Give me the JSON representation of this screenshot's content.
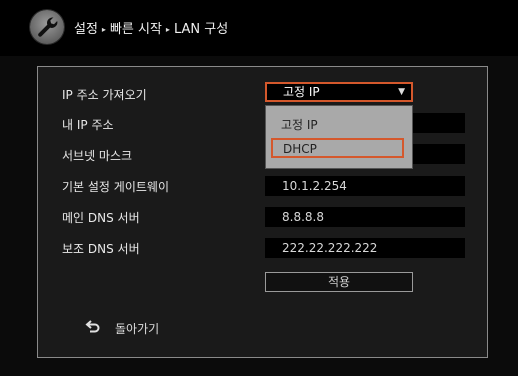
{
  "breadcrumb": {
    "items": [
      "설정",
      "빠른 시작",
      "LAN 구성"
    ],
    "separator": "▸"
  },
  "form": {
    "ip_mode": {
      "label": "IP 주소 가져오기",
      "value": "고정 IP",
      "arrow": "▼"
    },
    "ip_mode_options": [
      "고정 IP",
      "DHCP"
    ],
    "my_ip": {
      "label": "내 IP 주소",
      "value": ""
    },
    "subnet": {
      "label": "서브넷 마스크",
      "value": ""
    },
    "gateway": {
      "label": "기본 설정 게이트웨이",
      "value": "10.1.2.254"
    },
    "dns_primary": {
      "label": "메인 DNS 서버",
      "value": "8.8.8.8"
    },
    "dns_secondary": {
      "label": "보조 DNS 서버",
      "value": "222.22.222.222"
    },
    "apply_label": "적용"
  },
  "back_label": "돌아가기",
  "colors": {
    "accent": "#d4582c",
    "panel_border": "#8a8a8a",
    "dropdown_bg": "#a9a9a9"
  },
  "icons": {
    "settings": "wrench-icon",
    "back": "return-arrow-icon"
  }
}
